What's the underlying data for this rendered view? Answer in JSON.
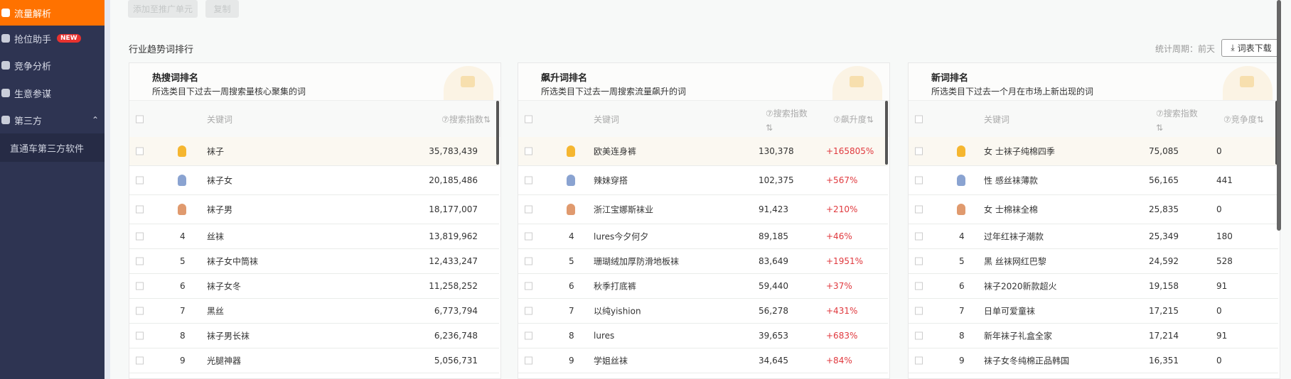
{
  "sidebar": {
    "items": [
      {
        "label": "流量解析",
        "active": true
      },
      {
        "label": "抢位助手",
        "badge": "NEW"
      },
      {
        "label": "竞争分析"
      },
      {
        "label": "生意参谋"
      },
      {
        "label": "第三方",
        "expanded": true
      }
    ],
    "sub_items": [
      "直通车第三方软件"
    ]
  },
  "toolbar": {
    "add_label": "添加至推广单元",
    "copy_label": "复制"
  },
  "section": {
    "title": "行业趋势词排行",
    "period": "统计周期：前天",
    "download": "词表下载"
  },
  "colors": {
    "accent": "#ff7200",
    "sidebar": "#2e3452",
    "rise": "#e0393e",
    "gold": "#f5b630",
    "silver": "#8aa3d1",
    "bronze": "#e09a6e"
  },
  "panels": [
    {
      "title": "热搜词排名",
      "desc": "所选类目下过去一周搜索量核心聚集的词",
      "cols": [
        "关键词",
        "⑦搜索指数⇅"
      ],
      "rows": [
        [
          "1",
          "袜子",
          "35,783,439"
        ],
        [
          "2",
          "袜子女",
          "20,185,486"
        ],
        [
          "3",
          "袜子男",
          "18,177,007"
        ],
        [
          "4",
          "丝袜",
          "13,819,962"
        ],
        [
          "5",
          "袜子女中筒袜",
          "12,433,247"
        ],
        [
          "6",
          "袜子女冬",
          "11,258,252"
        ],
        [
          "7",
          "黑丝",
          "6,773,794"
        ],
        [
          "8",
          "袜子男长袜",
          "6,236,748"
        ],
        [
          "9",
          "光腿神器",
          "5,056,731"
        ]
      ]
    },
    {
      "title": "飙升词排名",
      "desc": "所选类目下过去一周搜索流量飙升的词",
      "cols": [
        "关键词",
        "⑦搜索指数",
        "⇅",
        "⑦飙升度⇅"
      ],
      "rows": [
        [
          "1",
          "欧美连身裤",
          "130,378",
          "+165805%"
        ],
        [
          "2",
          "辣妹穿搭",
          "102,375",
          "+567%"
        ],
        [
          "3",
          "浙江宝娜斯袜业",
          "91,423",
          "+210%"
        ],
        [
          "4",
          "lures今夕何夕",
          "89,185",
          "+46%"
        ],
        [
          "5",
          "珊瑚绒加厚防滑地板袜",
          "83,649",
          "+1951%"
        ],
        [
          "6",
          "秋季打底裤",
          "59,440",
          "+37%"
        ],
        [
          "7",
          "以纯yishion",
          "56,278",
          "+431%"
        ],
        [
          "8",
          "lures",
          "39,653",
          "+683%"
        ],
        [
          "9",
          "学姐丝袜",
          "34,645",
          "+84%"
        ]
      ]
    },
    {
      "title": "新词排名",
      "desc": "所选类目下过去一个月在市场上新出现的词",
      "cols": [
        "关键词",
        "⑦搜索指数",
        "⇅",
        "⑦竞争度⇅"
      ],
      "rows": [
        [
          "1",
          "女 士袜子纯棉四季",
          "75,085",
          "0"
        ],
        [
          "2",
          "性 感丝袜薄款",
          "56,165",
          "441"
        ],
        [
          "3",
          "女 士棉袜全棉",
          "25,835",
          "0"
        ],
        [
          "4",
          "过年红袜子潮款",
          "25,349",
          "180"
        ],
        [
          "5",
          "黑 丝袜网红巴黎",
          "24,592",
          "528"
        ],
        [
          "6",
          "袜子2020新款超火",
          "19,158",
          "91"
        ],
        [
          "7",
          "日单可爱童袜",
          "17,215",
          "0"
        ],
        [
          "8",
          "新年袜子礼盒全家",
          "17,214",
          "91"
        ],
        [
          "9",
          "袜子女冬纯棉正品韩国",
          "16,351",
          "0"
        ]
      ]
    }
  ]
}
